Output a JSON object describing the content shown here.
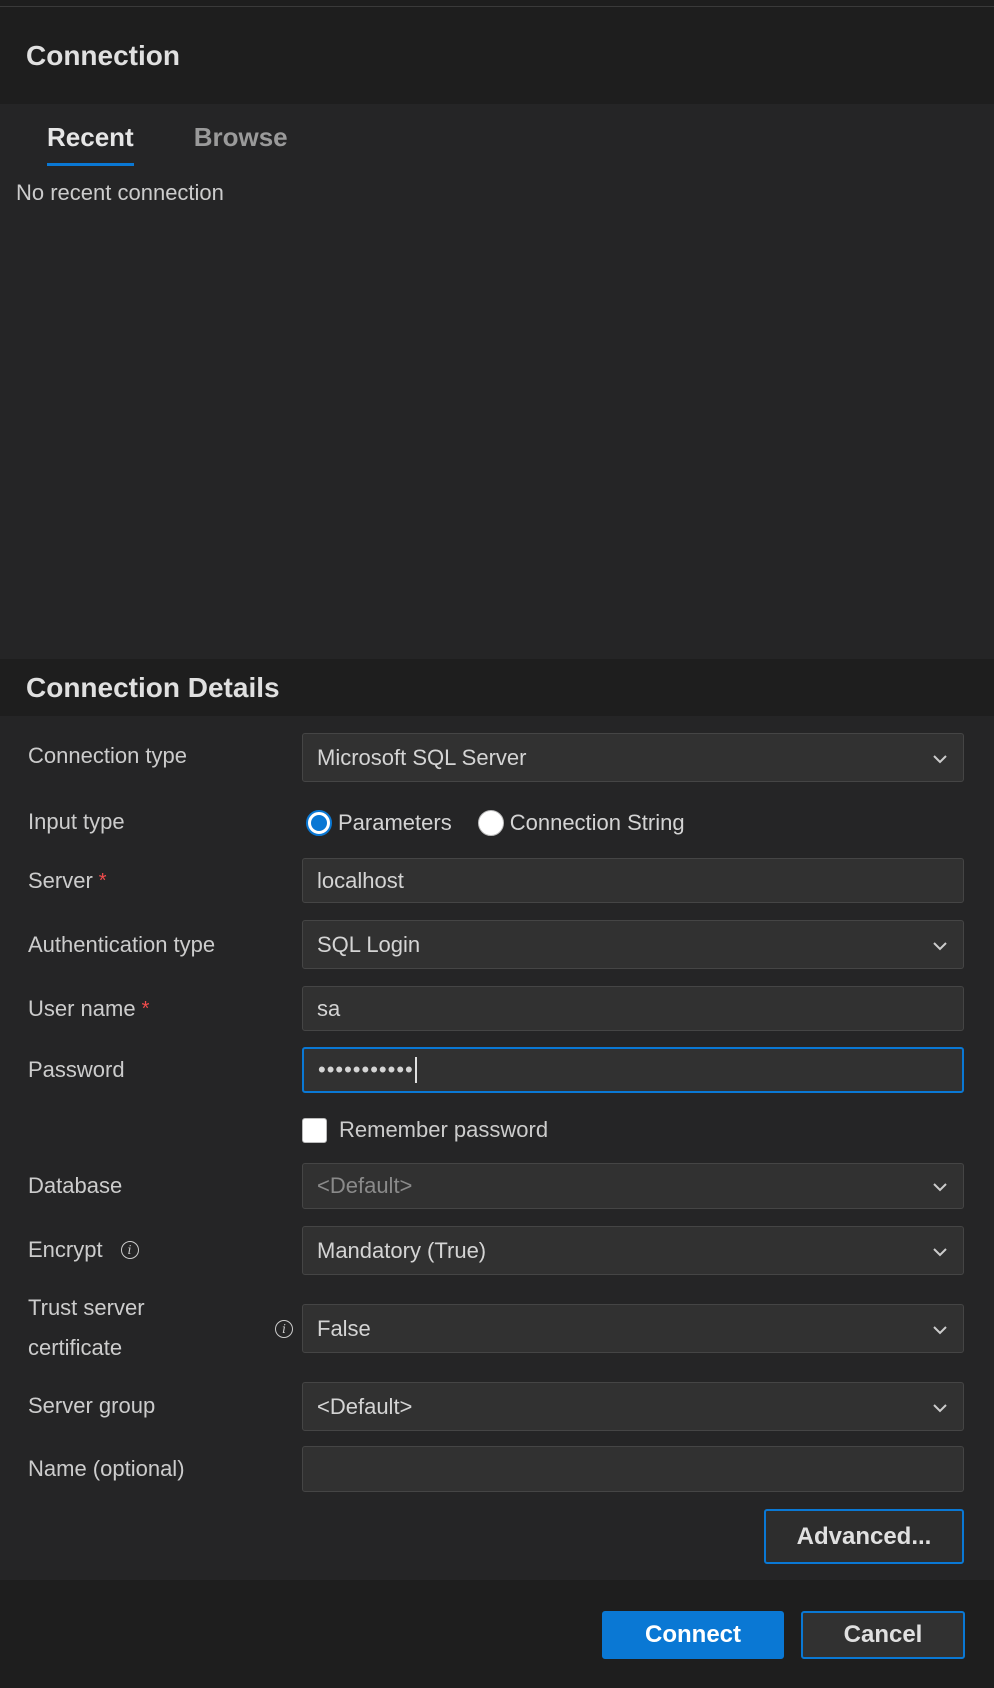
{
  "connection": {
    "title": "Connection",
    "tabs": [
      {
        "label": "Recent",
        "active": true
      },
      {
        "label": "Browse",
        "active": false
      }
    ],
    "empty_message": "No recent connection"
  },
  "details": {
    "title": "Connection Details",
    "connection_type": {
      "label": "Connection type",
      "value": "Microsoft SQL Server"
    },
    "input_type": {
      "label": "Input type",
      "options": [
        {
          "label": "Parameters",
          "selected": true
        },
        {
          "label": "Connection String",
          "selected": false
        }
      ]
    },
    "server": {
      "label": "Server",
      "required_mark": "*",
      "value": "localhost"
    },
    "auth_type": {
      "label": "Authentication type",
      "value": "SQL Login"
    },
    "user_name": {
      "label": "User name",
      "required_mark": "*",
      "value": "sa"
    },
    "password": {
      "label": "Password",
      "masked_value": "•••••••••••"
    },
    "remember_password": {
      "label": "Remember password",
      "checked": false
    },
    "database": {
      "label": "Database",
      "placeholder": "<Default>"
    },
    "encrypt": {
      "label": "Encrypt",
      "value": "Mandatory (True)"
    },
    "trust_cert": {
      "label_line1": "Trust server",
      "label_line2": "certificate",
      "value": "False"
    },
    "server_group": {
      "label": "Server group",
      "value": "<Default>"
    },
    "name": {
      "label": "Name (optional)",
      "value": ""
    },
    "advanced_label": "Advanced..."
  },
  "footer": {
    "connect_label": "Connect",
    "cancel_label": "Cancel"
  },
  "colors": {
    "accent": "#0a78d4",
    "required": "#f14c4c",
    "background": "#252526",
    "header_background": "#1e1e1e",
    "field_background": "#313131"
  }
}
